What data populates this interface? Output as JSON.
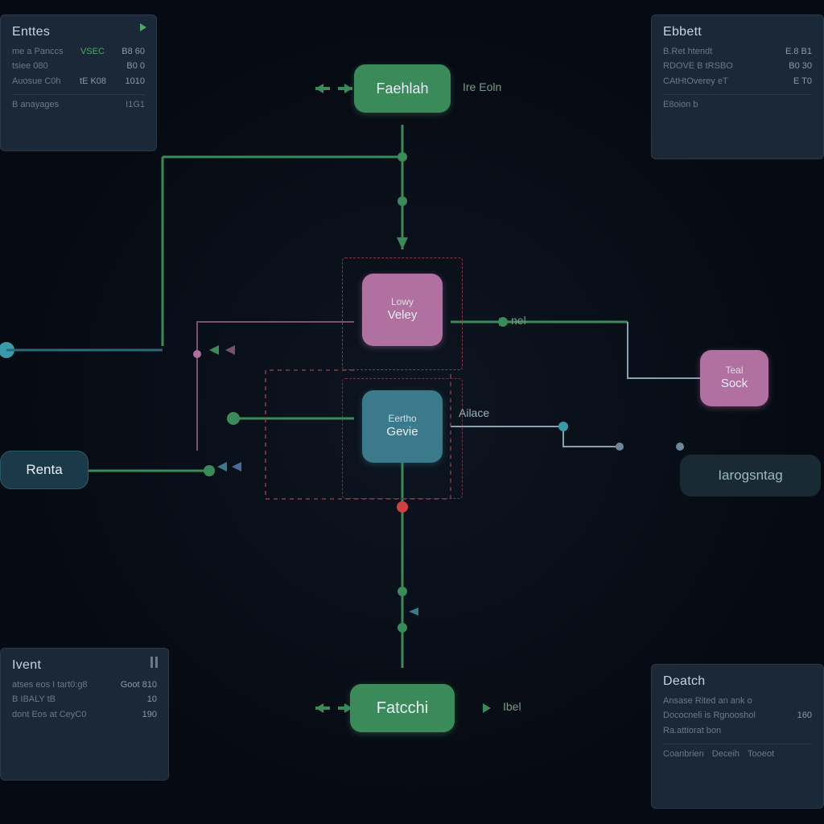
{
  "panels": {
    "top_left": {
      "title": "Enttes",
      "rows": [
        {
          "label": "me a Panccs",
          "value": "VSEC",
          "value_class": "green",
          "extra": "B8 60"
        },
        {
          "label": "tsiee 080",
          "value": "",
          "extra": "B0 0"
        },
        {
          "label": "Auosue C0h",
          "value": "tE K08",
          "extra": "1010"
        }
      ],
      "footer_left": "B anayages",
      "footer_right": "I1G1"
    },
    "top_right": {
      "title": "Ebbett",
      "rows": [
        {
          "label": "B.Ret htendt",
          "value": "",
          "extra": "E.8 B1"
        },
        {
          "label": "RDOVE B tRSBO",
          "value": "",
          "extra": "B0 30"
        },
        {
          "label": "CAtHtOverey eT",
          "value": "",
          "extra": "E T0"
        }
      ],
      "footer_left": "E8oion b",
      "footer_right": ""
    },
    "bottom_left": {
      "title": "Ivent",
      "rows": [
        {
          "label": "atses eos I tart0:g8",
          "value": "",
          "extra": "Goot 810"
        },
        {
          "label": "B IBALY tB",
          "value": "10",
          "extra": ""
        },
        {
          "label": "dont Eos at CeyC0",
          "value": "190",
          "extra": ""
        }
      ],
      "footer_left": "",
      "footer_right": ""
    },
    "bottom_right": {
      "title": "Deatch",
      "rows": [
        {
          "label": "Ansase Rited an ank o",
          "value": "",
          "extra": ""
        },
        {
          "label": "Dococneli is Rgnooshol",
          "value": "",
          "extra": "160"
        },
        {
          "label": "Ra.attiorat bon",
          "value": "",
          "extra": ""
        }
      ],
      "footer": [
        "Coanbrien",
        "Deceih",
        "Tooeot"
      ]
    }
  },
  "nodes": {
    "top": {
      "label": "Faehlah",
      "side": "Ire Eoln"
    },
    "mid_upper": {
      "small": "Lowy",
      "label": "Veley",
      "side": "nel"
    },
    "mid_lower": {
      "small": "Eertho",
      "label": "Gevie",
      "side": "Ailace"
    },
    "left": {
      "label": "Renta"
    },
    "right_small": {
      "small": "Teal",
      "label": "Sock"
    },
    "right_big": {
      "label": "Iarogsntag"
    },
    "bottom": {
      "label": "Fatcchi",
      "side": "Ibel"
    }
  },
  "colors": {
    "green": "#3a8a5a",
    "pink": "#b070a0",
    "teal": "#3a7a8a",
    "red": "#d04040"
  }
}
